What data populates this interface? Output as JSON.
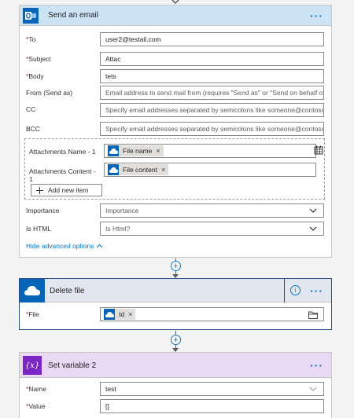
{
  "send_email": {
    "title": "Send an email",
    "more": "···",
    "fields": {
      "to": {
        "label": "To",
        "value": "user2@testail.com"
      },
      "subject": {
        "label": "Subject",
        "value": "Attac"
      },
      "body": {
        "label": "Body",
        "value": "tets"
      },
      "from": {
        "label": "From (Send as)",
        "placeholder": "Email address to send mail from (requires \"Send as\" or \"Send on behalf of\""
      },
      "cc": {
        "label": "CC",
        "placeholder": "Specify email addresses separated by semicolons like someone@contoso.com"
      },
      "bcc": {
        "label": "BCC",
        "placeholder": "Specify email addresses separated by semicolons like someone@contoso.com"
      },
      "attachments_name": {
        "label": "Attachments Name - 1",
        "token": "File name"
      },
      "attachments_content": {
        "label_line1": "Attachments Content -",
        "label_line2": "1",
        "token": "File content"
      },
      "add_new_item": "Add new item",
      "importance": {
        "label": "Importance",
        "value": "Importance"
      },
      "is_html": {
        "label": "Is HTML",
        "value": "Is Html?"
      }
    },
    "hide_advanced": "Hide advanced options"
  },
  "delete_file": {
    "title": "Delete file",
    "more": "···",
    "info": "i",
    "file": {
      "label": "File",
      "token": "Id"
    }
  },
  "set_variable": {
    "title": "Set variable 2",
    "more": "···",
    "icon_text": "{x}",
    "name": {
      "label": "Name",
      "value": "test"
    },
    "value": {
      "label": "Value",
      "value": "[]"
    }
  },
  "required_marker": "*",
  "token_remove": "×",
  "colors": {
    "outlook": "#0364b8",
    "onedrive": "#0364b8",
    "variable": "#7b26c4",
    "accent": "#0078d4"
  },
  "icons": [
    "outlook-icon",
    "onedrive-icon",
    "variable-icon",
    "plus-icon",
    "info-icon",
    "folder-icon",
    "calendar-table-icon",
    "chevron-down-icon",
    "chevron-up-icon"
  ]
}
